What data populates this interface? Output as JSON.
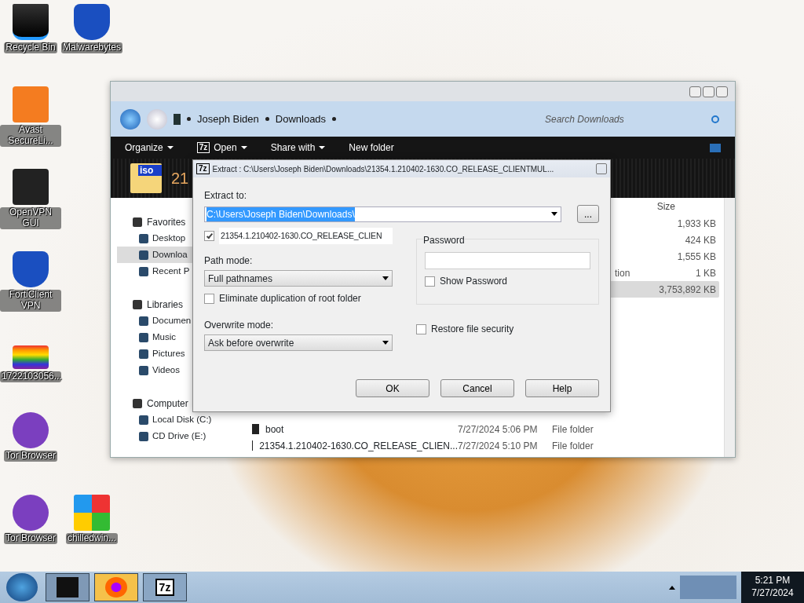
{
  "desktop_icons": [
    {
      "label": "Recycle Bin",
      "kind": "bin"
    },
    {
      "label": "Malwarebytes",
      "kind": "shield"
    },
    {
      "label": "Avast SecureLi...",
      "kind": "orange"
    },
    {
      "label": "OpenVPN GUI",
      "kind": "monitor"
    },
    {
      "label": "FortiClient VPN",
      "kind": "shield"
    },
    {
      "label": "1722103056...",
      "kind": "photo"
    },
    {
      "label": "Tor Browser",
      "kind": "tor"
    },
    {
      "label": "Tor Browser",
      "kind": "tor"
    },
    {
      "label": "chilledwin...",
      "kind": "windows"
    }
  ],
  "explorer": {
    "breadcrumb": [
      "Joseph Biden",
      "Downloads"
    ],
    "search": {
      "placeholder": "Search Downloads"
    },
    "toolbar": [
      {
        "label": "Organize",
        "kind": "plain",
        "dropdown": true
      },
      {
        "label": "Open",
        "kind": "archive",
        "icon_text": "7z",
        "dropdown": true
      },
      {
        "label": "Share with",
        "kind": "plain",
        "dropdown": true
      },
      {
        "label": "New folder",
        "kind": "plain",
        "dropdown": false
      }
    ],
    "header_icon_text": "iso",
    "header_title": "21",
    "nav": [
      {
        "label": "Favorites",
        "children": [
          {
            "label": "Desktop",
            "selected": false
          },
          {
            "label": "Downloa",
            "selected": true
          },
          {
            "label": "Recent P",
            "selected": false
          }
        ]
      },
      {
        "label": "Libraries",
        "children": [
          {
            "label": "Documen",
            "selected": false
          },
          {
            "label": "Music",
            "selected": false
          },
          {
            "label": "Pictures",
            "selected": false
          },
          {
            "label": "Videos",
            "selected": false
          }
        ]
      },
      {
        "label": "Computer",
        "children": [
          {
            "label": "Local Disk (C:)",
            "selected": false
          },
          {
            "label": "CD Drive (E:)",
            "selected": false
          }
        ]
      }
    ],
    "size_column": "Size",
    "rows_top": [
      {
        "size": "1,933 KB",
        "selected": false
      },
      {
        "size": "424 KB",
        "selected": false
      },
      {
        "size": "1,555 KB",
        "selected": false
      },
      {
        "type": "tion",
        "size": "1 KB",
        "selected": false
      },
      {
        "size": "3,753,892 KB",
        "selected": true
      }
    ],
    "rows_bottom": [
      {
        "name": "boot",
        "date": "7/27/2024 5:06 PM",
        "type": "File folder",
        "selected": false
      },
      {
        "name": "21354.1.210402-1630.CO_RELEASE_CLIEN...",
        "date": "7/27/2024 5:10 PM",
        "type": "File folder",
        "selected": false
      }
    ]
  },
  "dialog": {
    "title_icon_text": "7z",
    "title": "Extract : C:\\Users\\Joseph Biden\\Downloads\\21354.1.210402-1630.CO_RELEASE_CLIENTMUL...",
    "extract_to_label": "Extract to:",
    "extract_to": "C:\\Users\\Joseph Biden\\Downloads\\",
    "browse": "...",
    "folder_name": {
      "checked": true,
      "value": "21354.1.210402-1630.CO_RELEASE_CLIEN"
    },
    "path_mode_label": "Path mode:",
    "path_mode": "Full pathnames",
    "eliminate": {
      "label": "Eliminate duplication of root folder",
      "checked": false
    },
    "overwrite_label": "Overwrite mode:",
    "overwrite": "Ask before overwrite",
    "password_label": "Password",
    "show_password": {
      "label": "Show Password",
      "checked": false
    },
    "restore": {
      "label": "Restore file security",
      "checked": false
    },
    "buttons": [
      "OK",
      "Cancel",
      "Help"
    ]
  },
  "taskbar": {
    "apps": [
      {
        "kind": "monitor"
      },
      {
        "kind": "firefox"
      },
      {
        "kind": "archive",
        "icon_text": "7z"
      }
    ],
    "time": "5:21 PM",
    "date": "7/27/2024"
  }
}
